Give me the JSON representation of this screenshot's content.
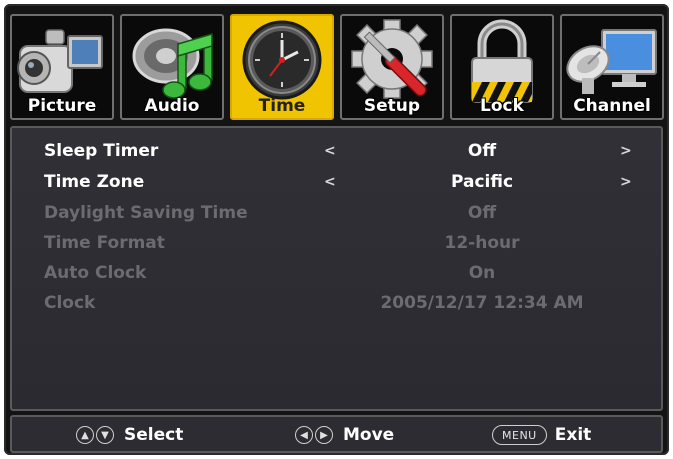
{
  "tabs": [
    {
      "label": "Picture",
      "icon": "camcorder-icon",
      "active": false
    },
    {
      "label": "Audio",
      "icon": "speaker-music-icon",
      "active": false
    },
    {
      "label": "Time",
      "icon": "clock-icon",
      "active": true
    },
    {
      "label": "Setup",
      "icon": "gear-wrench-icon",
      "active": false
    },
    {
      "label": "Lock",
      "icon": "padlock-icon",
      "active": false
    },
    {
      "label": "Channel",
      "icon": "satellite-monitor-icon",
      "active": false
    }
  ],
  "settings": [
    {
      "label": "Sleep Timer",
      "value": "Off",
      "enabled": true,
      "left_arrow": "<",
      "right_arrow": ">"
    },
    {
      "label": "Time Zone",
      "value": "Pacific",
      "enabled": true,
      "left_arrow": "<",
      "right_arrow": ">"
    },
    {
      "label": "Daylight Saving Time",
      "value": "Off",
      "enabled": false
    },
    {
      "label": "Time Format",
      "value": "12-hour",
      "enabled": false
    },
    {
      "label": "Auto Clock",
      "value": "On",
      "enabled": false
    },
    {
      "label": "Clock",
      "value": "2005/12/17 12:34 AM",
      "enabled": false
    }
  ],
  "footer": {
    "select_label": "Select",
    "move_label": "Move",
    "menu_key": "MENU",
    "exit_label": "Exit"
  },
  "colors": {
    "active_tab": "#f0c400",
    "enabled_text": "#ffffff",
    "disabled_text": "#6b6b70",
    "panel_bg": "#2e2e34"
  }
}
